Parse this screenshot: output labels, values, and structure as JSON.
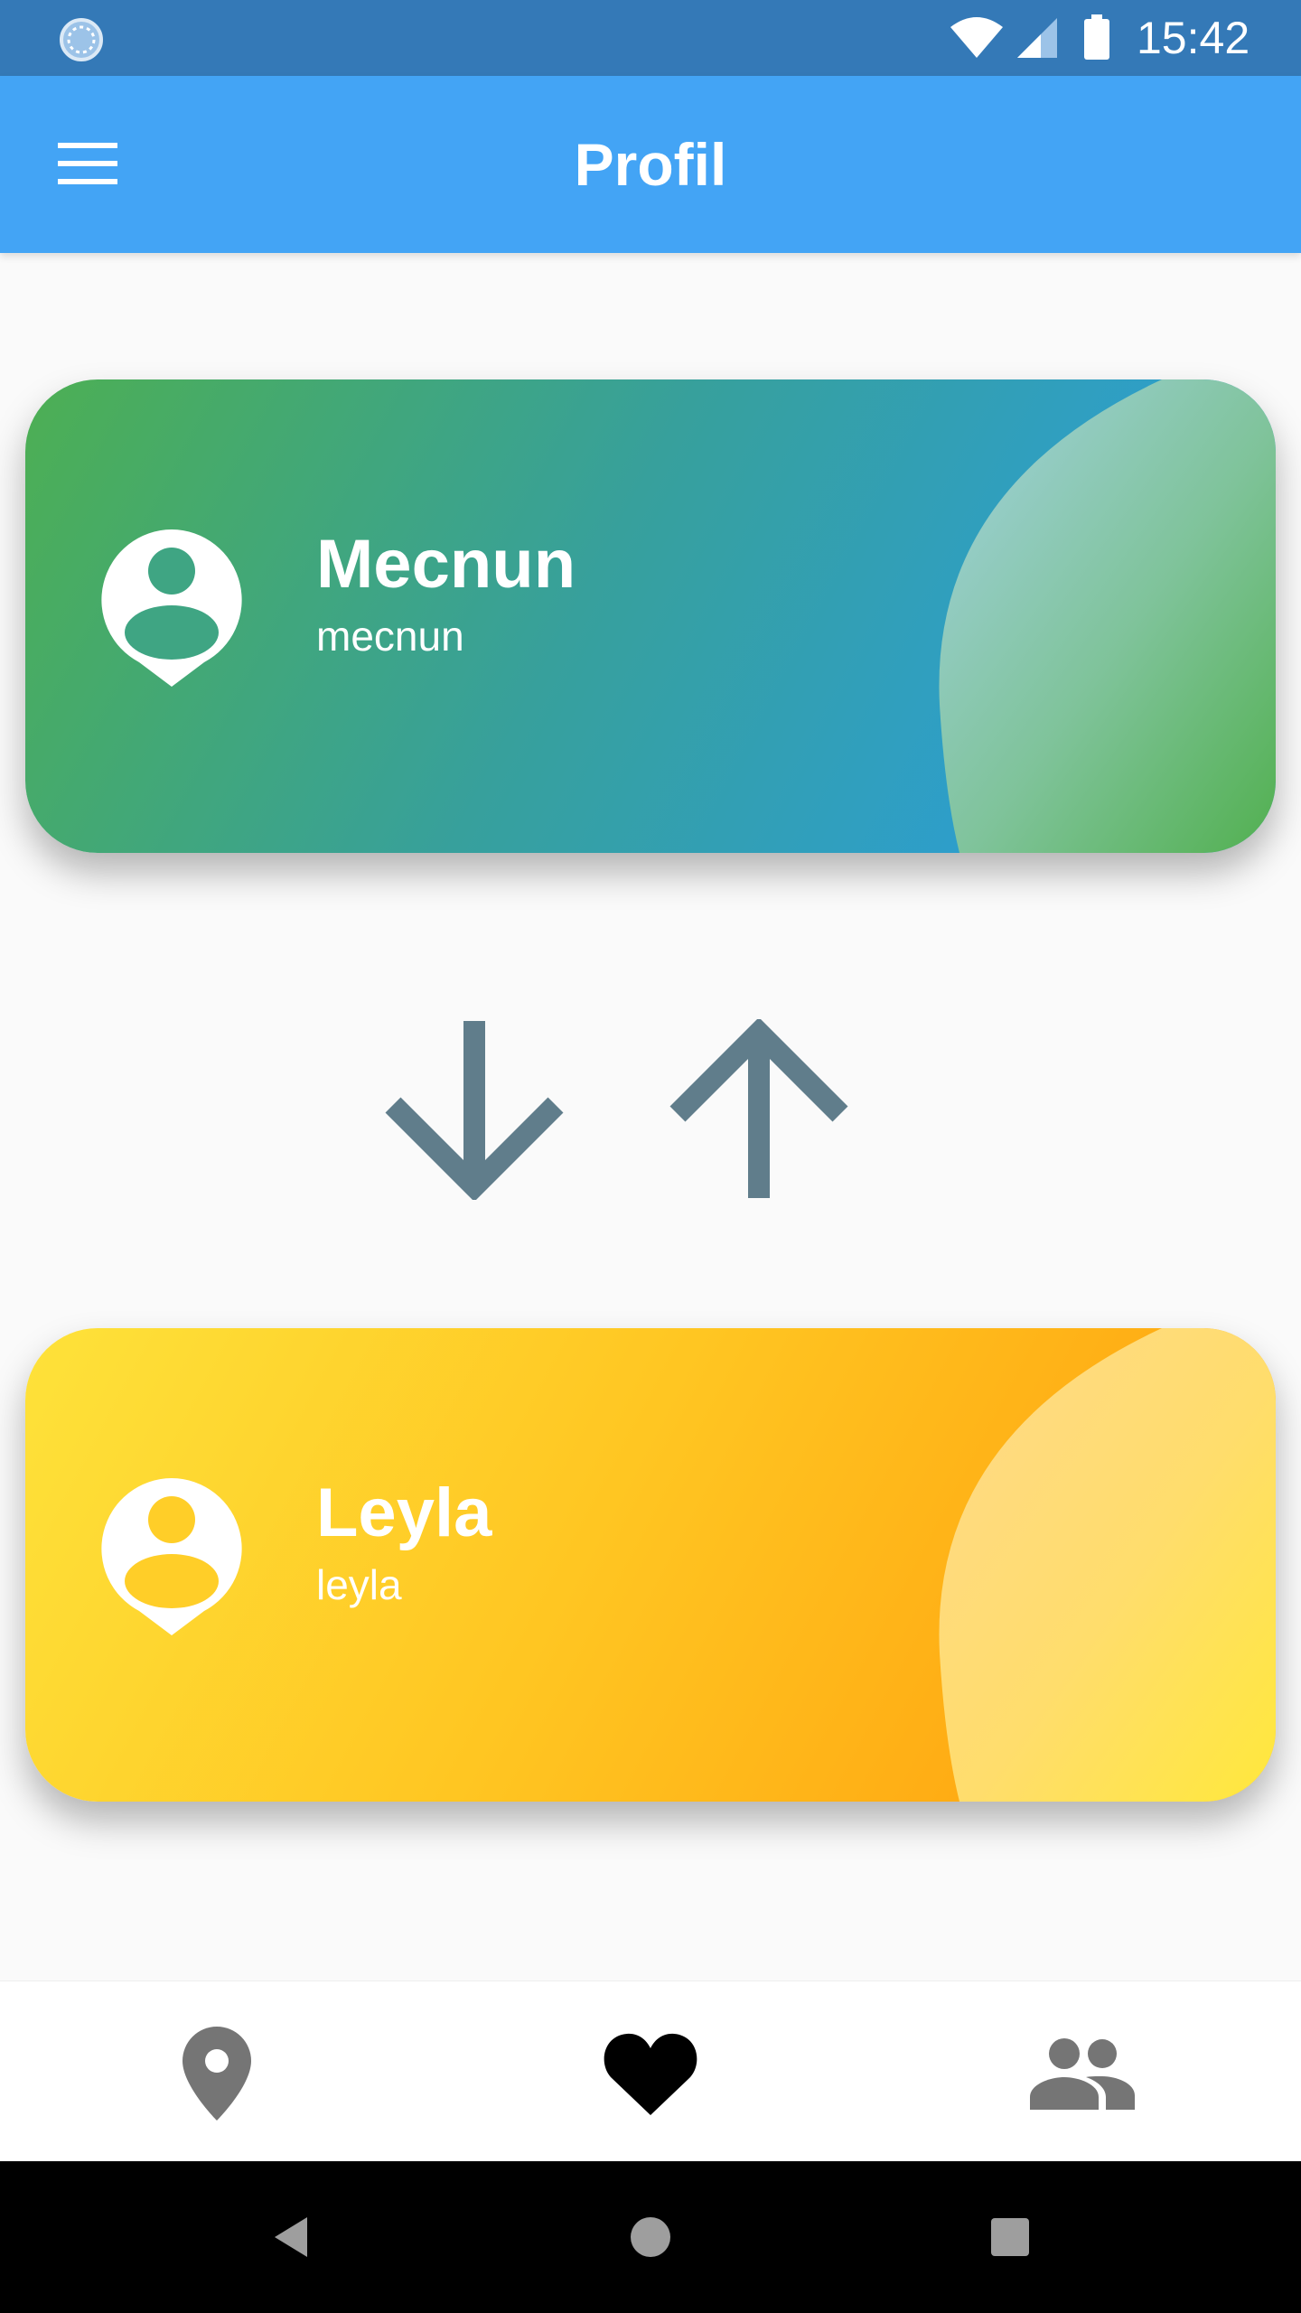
{
  "status_bar": {
    "time": "15:42",
    "icons": [
      "sync-icon",
      "wifi-icon",
      "cell-signal-icon",
      "battery-icon"
    ],
    "background": "#3479b7"
  },
  "app_bar": {
    "title": "Profil",
    "menu_icon": "menu-icon",
    "background": "#43a4f5"
  },
  "cards": [
    {
      "name": "Mecnun",
      "username": "mecnun",
      "icon": "profile-pin-icon",
      "colors": [
        "#4daf53",
        "#2b9ed7"
      ]
    },
    {
      "name": "Leyla",
      "username": "leyla",
      "icon": "profile-pin-icon",
      "colors": [
        "#fee23a",
        "#ffa510"
      ]
    }
  ],
  "arrows": {
    "left": "arrow-down-icon",
    "right": "arrow-up-icon",
    "color": "#607d8b"
  },
  "bottom_nav": {
    "items": [
      {
        "icon": "location-pin-icon",
        "selected": false
      },
      {
        "icon": "heart-icon",
        "selected": true
      },
      {
        "icon": "people-icon",
        "selected": false
      }
    ]
  },
  "system_nav": {
    "icons": [
      "back-icon",
      "home-icon",
      "recents-icon"
    ]
  }
}
